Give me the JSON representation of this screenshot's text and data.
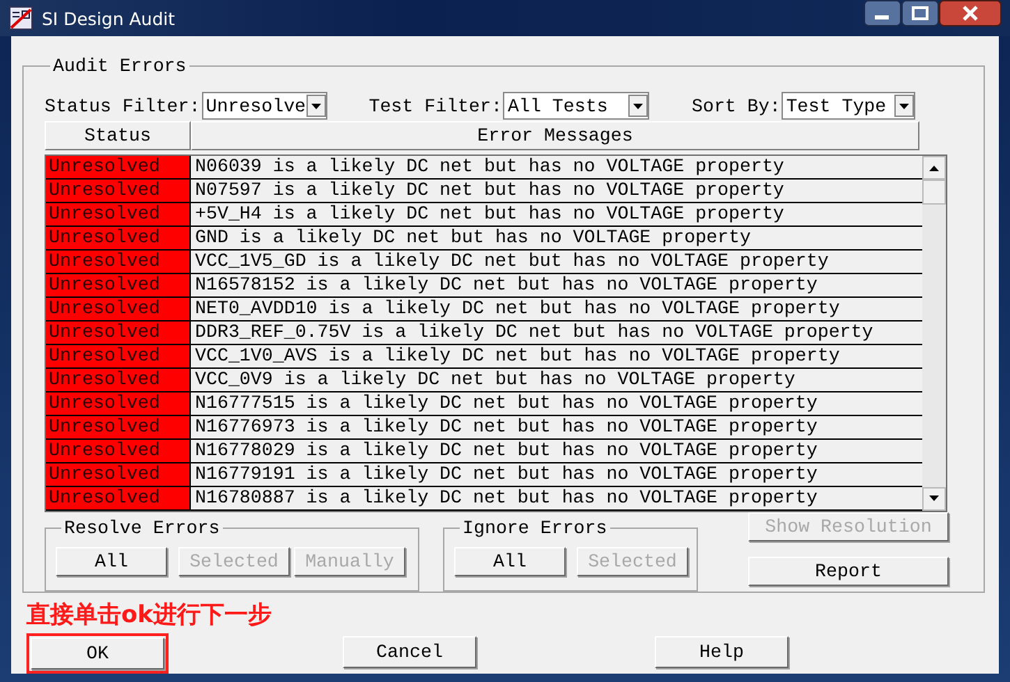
{
  "window": {
    "title": "SI Design Audit"
  },
  "audit_errors": {
    "title": "Audit Errors",
    "filters": [
      {
        "label": "Status Filter:",
        "value": "Unresolve"
      },
      {
        "label": "Test Filter:",
        "value": "All Tests"
      },
      {
        "label": "Sort By:",
        "value": "Test Type"
      }
    ],
    "table": {
      "columns": [
        "Status",
        "Error Messages"
      ],
      "rows": [
        {
          "status": "Unresolved",
          "message": "N06039 is a likely DC net but has no VOLTAGE property"
        },
        {
          "status": "Unresolved",
          "message": "N07597 is a likely DC net but has no VOLTAGE property"
        },
        {
          "status": "Unresolved",
          "message": "+5V_H4 is a likely DC net but has no VOLTAGE property"
        },
        {
          "status": "Unresolved",
          "message": "GND is a likely DC net but has no VOLTAGE property"
        },
        {
          "status": "Unresolved",
          "message": "VCC_1V5_GD is a likely DC net but has no VOLTAGE property"
        },
        {
          "status": "Unresolved",
          "message": "N16578152 is a likely DC net but has no VOLTAGE property"
        },
        {
          "status": "Unresolved",
          "message": "NET0_AVDD10 is a likely DC net but has no VOLTAGE property"
        },
        {
          "status": "Unresolved",
          "message": "DDR3_REF_0.75V is a likely DC net but has no VOLTAGE property"
        },
        {
          "status": "Unresolved",
          "message": "VCC_1V0_AVS is a likely DC net but has no VOLTAGE property"
        },
        {
          "status": "Unresolved",
          "message": "VCC_0V9 is a likely DC net but has no VOLTAGE property"
        },
        {
          "status": "Unresolved",
          "message": "N16777515 is a likely DC net but has no VOLTAGE property"
        },
        {
          "status": "Unresolved",
          "message": "N16776973 is a likely DC net but has no VOLTAGE property"
        },
        {
          "status": "Unresolved",
          "message": "N16778029 is a likely DC net but has no VOLTAGE property"
        },
        {
          "status": "Unresolved",
          "message": "N16779191 is a likely DC net but has no VOLTAGE property"
        },
        {
          "status": "Unresolved",
          "message": "N16780887 is a likely DC net but has no VOLTAGE property"
        }
      ]
    },
    "resolve_errors": {
      "title": "Resolve Errors",
      "buttons": [
        {
          "label": "All",
          "disabled": false
        },
        {
          "label": "Selected",
          "disabled": true
        },
        {
          "label": "Manually",
          "disabled": true
        }
      ]
    },
    "ignore_errors": {
      "title": "Ignore Errors",
      "buttons": [
        {
          "label": "All",
          "disabled": false
        },
        {
          "label": "Selected",
          "disabled": true
        }
      ]
    },
    "side_buttons": [
      {
        "label": "Show Resolution",
        "disabled": true
      },
      {
        "label": "Report",
        "disabled": false
      }
    ]
  },
  "annotation": {
    "text": "直接单击ok进行下一步"
  },
  "footer_buttons": [
    {
      "label": "OK",
      "highlighted": true
    },
    {
      "label": "Cancel",
      "highlighted": false
    },
    {
      "label": "Help",
      "highlighted": false
    }
  ]
}
